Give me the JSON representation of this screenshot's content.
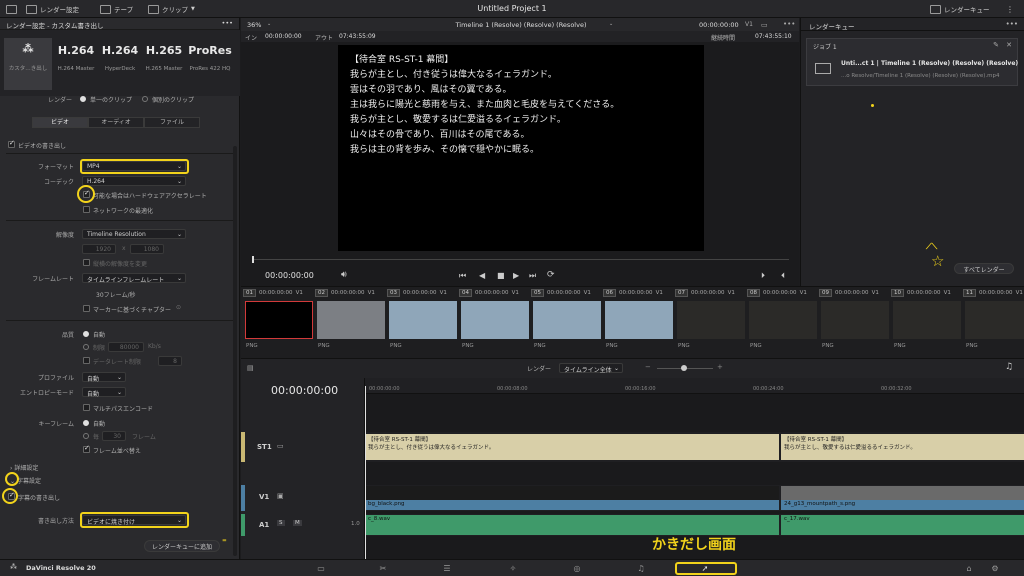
{
  "topbar": {
    "render_settings_label": "レンダー設定",
    "tape_label": "テープ",
    "clip_label": "クリップ",
    "project_title": "Untitled Project 1",
    "render_queue_label": "レンダーキュー"
  },
  "left_panel": {
    "title": "レンダー設定 - カスタム書き出し",
    "presets": [
      {
        "big": "",
        "small": "カスタ…き出し"
      },
      {
        "big": "H.264",
        "small": "H.264 Master"
      },
      {
        "big": "H.264",
        "small": "HyperDeck"
      },
      {
        "big": "H.265",
        "small": "H.265 Master"
      },
      {
        "big": "ProRes",
        "small": "ProRes 422 HQ"
      }
    ],
    "render_label": "レンダー",
    "single_clip": "単一のクリップ",
    "individual_clips": "個別のクリップ",
    "tabs": [
      "ビデオ",
      "オーディオ",
      "ファイル"
    ],
    "export_video": "ビデオの書き出し",
    "format_label": "フォーマット",
    "format_value": "MP4",
    "codec_label": "コーデック",
    "codec_value": "H.264",
    "hw_accel": "可能な場合はハードウェアアクセラレート",
    "network_opt": "ネットワークの最適化",
    "resolution_label": "解像度",
    "resolution_value": "Timeline Resolution",
    "res_w": "1920",
    "res_x": "x",
    "res_h": "1080",
    "res_aspect": "縦横の解像度を変更",
    "framerate_label": "フレームレート",
    "framerate_value": "タイムラインフレームレート",
    "framerate_sub": "30フレーム/秒",
    "chapters": "マーカーに基づくチャプター",
    "quality_label": "品質",
    "quality_auto": "自動",
    "quality_limit": "制限",
    "quality_limit_value": "80000",
    "quality_limit_unit": "Kb/s",
    "data_rate_limit": "データレート制限",
    "data_rate_value": "8",
    "profile_label": "プロファイル",
    "profile_value": "自動",
    "entropy_label": "エントロピーモード",
    "entropy_value": "自動",
    "multipass": "マルチパスエンコード",
    "keyframe_label": "キーフレーム",
    "keyframe_auto": "自動",
    "keyframe_every": "毎",
    "keyframe_every_value": "30",
    "keyframe_unit": "フレーム",
    "frame_reorder": "フレーム並べ替え",
    "advanced": "詳細設定",
    "subtitle_settings": "字幕設定",
    "export_subtitles": "字幕の書き出し",
    "export_method_label": "書き出し方法",
    "export_method_value": "ビデオに焼き付け",
    "add_to_queue": "レンダーキューに追加"
  },
  "viewer": {
    "zoom": "36%",
    "timeline_name": "Timeline 1 (Resolve) (Resolve) (Resolve)",
    "top_tc": "00:00:00:00",
    "v1": "V1",
    "in_label": "イン",
    "in_tc": "00:00:00:00",
    "out_label": "アウト",
    "out_tc": "07:43:55:09",
    "duration_label": "継続時間",
    "duration_tc": "07:43:55:10",
    "subtitle_lines": "【待合室 RS-ST-1 幕間】\n我らが主とし、付き従うは偉大なるイェラガンド。\n雲はその羽であり、風はその翼である。\n主は我らに陽光と慈雨を与え、また血肉と毛皮を与えてくださる。\n我らが主とし、敬愛するは仁愛溢るるイェラガンド。\n山々はその骨であり、百川はその尾である。\n我らは主の背を歩み、その懐で穏やかに眠る。",
    "current_tc": "00:00:00:00"
  },
  "render_queue": {
    "title": "レンダーキュー",
    "job_label": "ジョブ 1",
    "job_title": "Unti...ct 1 | Timeline 1 (Resolve) (Resolve) (Resolve)",
    "job_path": "...o Resolve/Timeline 1 (Resolve) (Resolve) (Resolve).mp4",
    "render_all": "すべてレンダー"
  },
  "clips": [
    {
      "num": "01",
      "tc": "00:00:00:00",
      "track": "V1",
      "fmt": "PNG"
    },
    {
      "num": "02",
      "tc": "00:00:00:00",
      "track": "V1",
      "fmt": "PNG"
    },
    {
      "num": "03",
      "tc": "00:00:00:00",
      "track": "V1",
      "fmt": "PNG"
    },
    {
      "num": "04",
      "tc": "00:00:00:00",
      "track": "V1",
      "fmt": "PNG"
    },
    {
      "num": "05",
      "tc": "00:00:00:00",
      "track": "V1",
      "fmt": "PNG"
    },
    {
      "num": "06",
      "tc": "00:00:00:00",
      "track": "V1",
      "fmt": "PNG"
    },
    {
      "num": "07",
      "tc": "00:00:00:00",
      "track": "V1",
      "fmt": "PNG"
    },
    {
      "num": "08",
      "tc": "00:00:00:00",
      "track": "V1",
      "fmt": "PNG"
    },
    {
      "num": "09",
      "tc": "00:00:00:00",
      "track": "V1",
      "fmt": "PNG"
    },
    {
      "num": "10",
      "tc": "00:00:00:00",
      "track": "V1",
      "fmt": "PNG"
    },
    {
      "num": "11",
      "tc": "00:00:00:00",
      "track": "V1",
      "fmt": "PNG"
    }
  ],
  "timeline": {
    "render_label": "レンダー",
    "render_range": "タイムライン全体",
    "tc": "00:00:00:00",
    "ruler": [
      "00:00:00:00",
      "00:00:08:00",
      "00:00:16:00",
      "00:00:24:00",
      "00:00:32:00"
    ],
    "st1_label": "ST1",
    "v1_label": "V1",
    "a1_label": "A1",
    "a1_s": "S",
    "a1_m": "M",
    "a1_vol": "1.0",
    "sub_clip1": "【待合室 RS-ST-1 幕間】\n我らが主とし、付き従うは偉大なるイェラガンド。",
    "sub_clip2": "【待合室 RS-ST-1 幕間】\n我らが主とし、敬愛するは仁愛溢るるイェラガンド。",
    "v_clip1": "bg_black.png",
    "v_clip2": "24_g13_mountpath_s.png",
    "a_clip1": "c_8.wav",
    "a_clip2": "c_17.wav"
  },
  "bottombar": {
    "app_name": "DaVinci Resolve 20"
  },
  "annotation": {
    "text": "かきだし画面"
  },
  "colors": {
    "highlight": "#f2d31b",
    "subtitle_clip": "#d8cfa8",
    "video_clip": "#4d7fa3",
    "audio_clip": "#3f9a6a"
  }
}
